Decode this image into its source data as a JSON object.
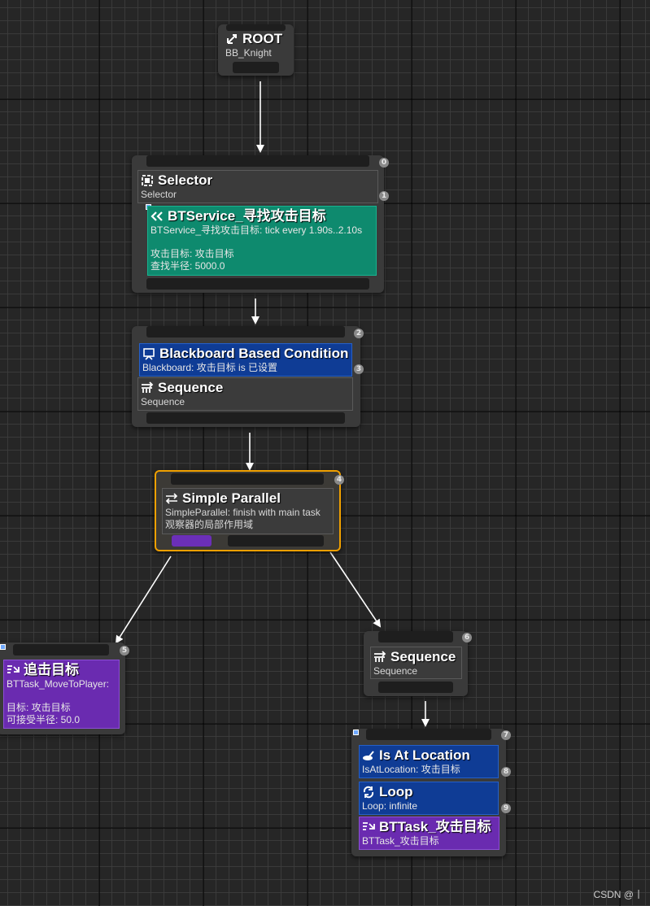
{
  "nodes": {
    "root": {
      "title": "ROOT",
      "subtitle": "BB_Knight"
    },
    "selector": {
      "badges": [
        "0",
        "1"
      ],
      "title": "Selector",
      "subtitle": "Selector",
      "service": {
        "title": "BTService_寻找攻击目标",
        "line1": "BTService_寻找攻击目标: tick every 1.90s..2.10s",
        "line2": "攻击目标: 攻击目标",
        "line3": "查找半径: 5000.0"
      }
    },
    "condition_seq": {
      "badges": [
        "2",
        "3"
      ],
      "decorator": {
        "title": "Blackboard Based Condition",
        "subtitle": "Blackboard: 攻击目标 is 已设置"
      },
      "title": "Sequence",
      "subtitle": "Sequence"
    },
    "parallel": {
      "badge": "4",
      "title": "Simple Parallel",
      "line1": "SimpleParallel: finish with main task",
      "line2": "观察器的局部作用域"
    },
    "chase": {
      "badge": "5",
      "title": "追击目标",
      "line1": "BTTask_MoveToPlayer:",
      "line2": "目标: 攻击目标",
      "line3": "可接受半径: 50.0"
    },
    "seq2": {
      "badge": "6",
      "title": "Sequence",
      "subtitle": "Sequence"
    },
    "attack": {
      "badges": [
        "7",
        "8",
        "9"
      ],
      "at_location": {
        "title": "Is At Location",
        "subtitle": "IsAtLocation: 攻击目标"
      },
      "loop": {
        "title": "Loop",
        "subtitle": "Loop: infinite"
      },
      "task": {
        "title": "BTTask_攻击目标",
        "subtitle": "BTTask_攻击目标"
      }
    }
  },
  "watermark": "CSDN @丨",
  "colors": {
    "service": "#0e8a6e",
    "decorator": "#0f3c95",
    "task": "#6a2bb0",
    "selected_outline": "#f0a000",
    "node_body": "#3a3a3a"
  }
}
